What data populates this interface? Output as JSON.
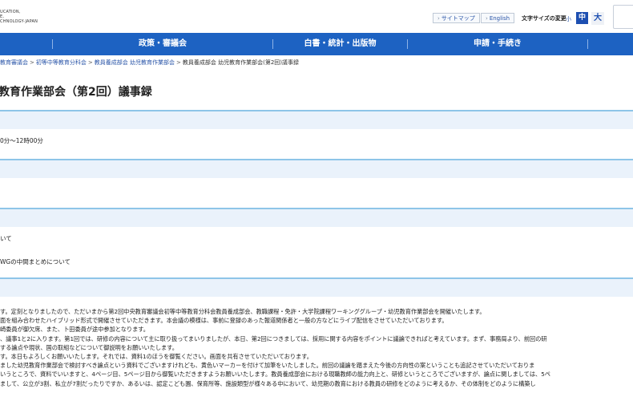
{
  "header": {
    "logo_lines": [
      "UCATION,",
      "E,",
      "CHNOLOGY-JAPAN"
    ],
    "sitemap": "サイトマップ",
    "english": "English",
    "font_size_label": "文字サイズの変更",
    "font_small": "小",
    "font_medium": "中",
    "font_large": "大"
  },
  "nav": {
    "items": [
      "政策・審議会",
      "白書・統計・出版物",
      "申請・手続き"
    ]
  },
  "breadcrumb": {
    "items": [
      "教育審議会",
      "初等中等教育分科会",
      "教員養成部会 幼児教育作業部会",
      "教員養成部会 幼児教育作業部会(第2回)議事録"
    ]
  },
  "page": {
    "title": "教育作業部会（第2回）議事録"
  },
  "content": {
    "time": "0分～12時00分",
    "agenda_1": "いて",
    "agenda_2": "WGの中間まとめについて"
  },
  "minutes": [
    "す。定刻となりましたので、ただいまから第2回中央教育審議会初等中等教育分科会教員養成部会、教職課程・免許・大学院課程ワーキンググループ・幼児教育作業部会を開催いたします。",
    "面を組み合わせたハイブリッド形式で開催させていただきます。本会議の模様は、事前に登録のあった報道関係者と一般の方などにライブ配信をさせていただいております。",
    "崎委員が御欠席、また、卜田委員が途中参加となります。",
    "、議事1と2に入ります。第1回では、研修の内容について主に取り扱ってまいりましたが、本日、第2回につきましては、採用に関する内容をポイントに議論できればと考えています。まず、事務局より、前回の研",
    "する論点や現状、国の取組などについて御説明をお願いいたします。",
    "す。本日もよろしくお願いいたします。それでは、資料1のほうを御覧ください。画面を共有させていただいております。",
    "ました幼児教育作業部会で検討すべき論点という資料でございますけれども、黄色いマーカーを付けて加筆をいたしました。前回の議論を踏まえた今後の方向性の案ということも追記させていただいておりま",
    "いうところで、資料でいいますと、4ページ目、5ページ目から御覧いただきますようお願いいたします。教員養成部会における現職教師の能力向上と、研修というところでございますが、論点に関しましては、5ペ",
    "まして、公立が3割、私立が7割だったりですか、あるいは、認定こども園、保育所等、施設類型が様々ある中において、幼児期の教育における教員の研修をどのように考えるか、その体制をどのように構築し"
  ]
}
